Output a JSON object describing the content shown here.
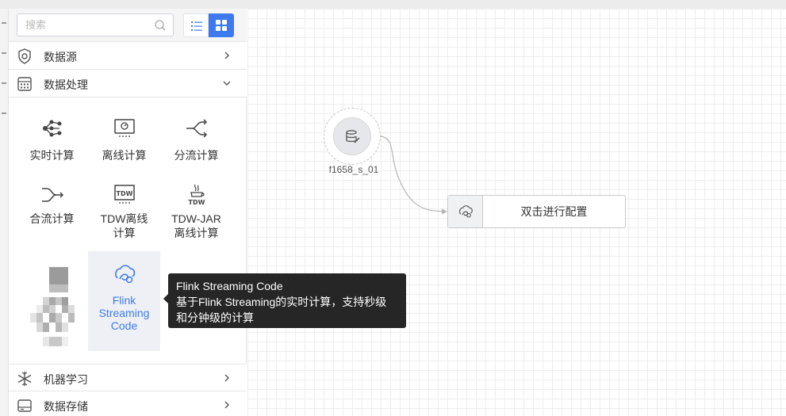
{
  "search": {
    "placeholder": "搜索"
  },
  "view_toggle": {
    "list_icon": "list-icon",
    "grid_icon": "grid-icon",
    "active": "grid"
  },
  "categories": {
    "data_source": {
      "label": "数据源",
      "icon": "database-shield-icon",
      "expanded": false
    },
    "data_processing": {
      "label": "数据处理",
      "icon": "calculator-icon",
      "expanded": true
    },
    "machine_learning": {
      "label": "机器学习",
      "icon": "snowflake-icon",
      "expanded": false
    },
    "data_storage": {
      "label": "数据存储",
      "icon": "storage-drive-icon",
      "expanded": false
    }
  },
  "tiles": [
    {
      "label": "实时计算",
      "icon": "realtime-compute-icon"
    },
    {
      "label": "离线计算",
      "icon": "offline-compute-icon"
    },
    {
      "label": "分流计算",
      "icon": "split-flow-icon"
    },
    {
      "label": "合流计算",
      "icon": "merge-flow-icon"
    },
    {
      "label_line1": "TDW离线",
      "label_line2": "计算",
      "icon": "tdw-icon"
    },
    {
      "label_line1": "TDW-JAR",
      "label_line2": "离线计算",
      "icon": "tdw-jar-icon"
    },
    {
      "label_line1": "Flink",
      "label_line2": "Streaming",
      "label_line3": "Code",
      "icon": "flink-icon",
      "selected": true
    }
  ],
  "tooltip": {
    "title": "Flink Streaming Code",
    "line1": "基于Flink Streaming的实时计算，支持秒级",
    "line2": "和分钟级的计算"
  },
  "canvas": {
    "source_node": {
      "label": "f1658_s_01",
      "icon": "database-edit-icon"
    },
    "config_node": {
      "label": "双击进行配置",
      "icon": "flink-icon"
    }
  },
  "colors": {
    "accent": "#3d7af0",
    "tooltip_bg": "#262626",
    "grid_line": "#eeeeee"
  }
}
